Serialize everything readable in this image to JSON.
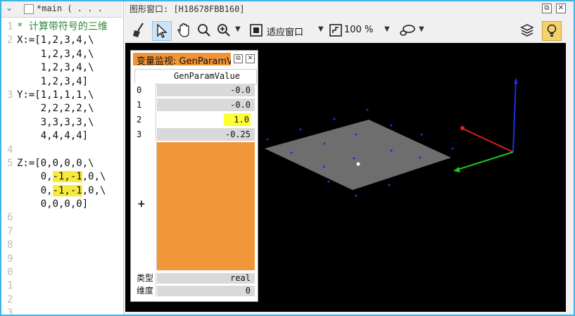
{
  "editor": {
    "tab_title": "*main ( . . .",
    "line_numbers": [
      "1",
      "2",
      "",
      "",
      "",
      "3",
      "",
      "",
      "",
      "4",
      "5",
      "",
      "",
      "",
      "6",
      "7",
      "8",
      "9",
      "0",
      "1",
      "2",
      "3"
    ],
    "lines": [
      {
        "type": "comment",
        "text": "* 计算带符号的三维"
      },
      {
        "type": "code",
        "text": "X:=[1,2,3,4,\\"
      },
      {
        "type": "code",
        "text": "    1,2,3,4,\\"
      },
      {
        "type": "code",
        "text": "    1,2,3,4,\\"
      },
      {
        "type": "code",
        "text": "    1,2,3,4]"
      },
      {
        "type": "code",
        "text": "Y:=[1,1,1,1,\\"
      },
      {
        "type": "code",
        "text": "    2,2,2,2,\\"
      },
      {
        "type": "code",
        "text": "    3,3,3,3,\\"
      },
      {
        "type": "code",
        "text": "    4,4,4,4]"
      },
      {
        "type": "blank",
        "text": ""
      },
      {
        "type": "code",
        "text": "Z:=[0,0,0,0,\\"
      },
      {
        "type": "hl",
        "pre": "    0,",
        "hl": "-1,-1",
        "post": ",0,\\"
      },
      {
        "type": "hl",
        "pre": "    0,",
        "hl": "-1,-1",
        "post": ",0,\\"
      },
      {
        "type": "code",
        "text": "    0,0,0,0]"
      }
    ]
  },
  "graphics_window": {
    "title": "图形窗口: [H18678FBB160]",
    "toolbar": {
      "fit_label": "适应窗口",
      "zoom_value": "100 %"
    }
  },
  "monitor": {
    "title": "变量监视: GenParamValue",
    "column_header": "GenParamValue",
    "rows": [
      {
        "index": "0",
        "value": "-0.0"
      },
      {
        "index": "1",
        "value": "-0.0"
      },
      {
        "index": "2",
        "value": "1.0"
      },
      {
        "index": "3",
        "value": "-0.25"
      }
    ],
    "plus": "+",
    "type_label": "类型",
    "type_value": "real",
    "dim_label": "维度",
    "dim_value": "0"
  }
}
